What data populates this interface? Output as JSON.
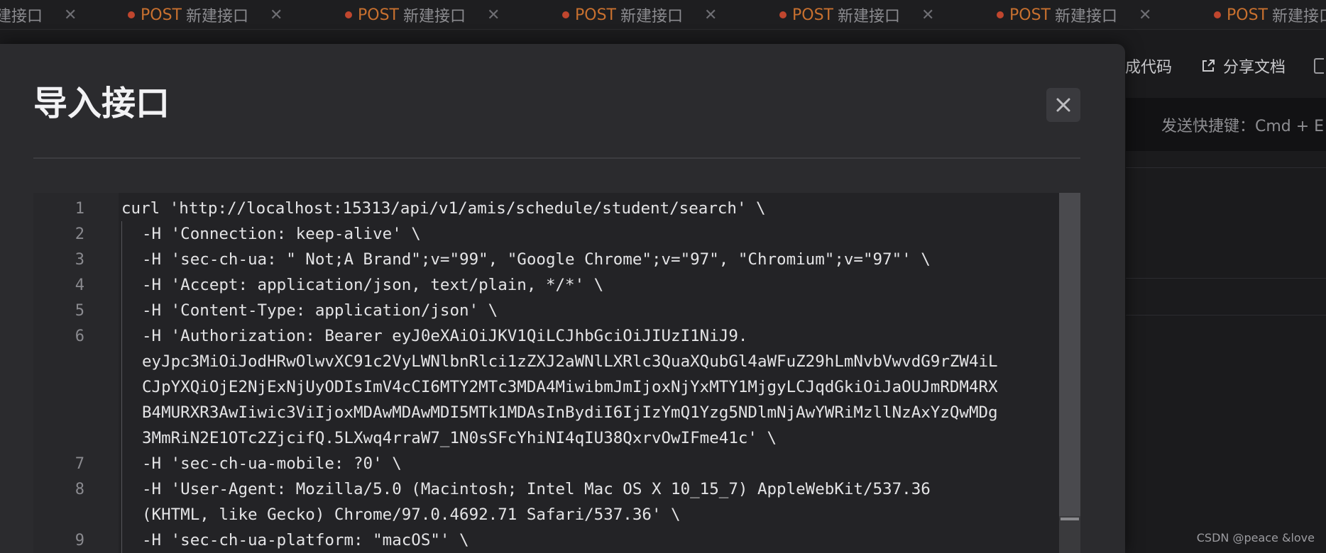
{
  "tabs": [
    {
      "method": "",
      "name": "建接口"
    },
    {
      "method": "POST",
      "name": "新建接口"
    },
    {
      "method": "POST",
      "name": "新建接口"
    },
    {
      "method": "POST",
      "name": "新建接口"
    },
    {
      "method": "POST",
      "name": "新建接口"
    },
    {
      "method": "POST",
      "name": "新建接口"
    },
    {
      "method": "POST",
      "name": "新建接口"
    }
  ],
  "tab_close_glyph": "✕",
  "colors": {
    "method_post": "#c8702f",
    "dot": "#c0462e"
  },
  "toolbar": {
    "generate_code_label": "成代码",
    "share_doc_label": "分享文档"
  },
  "send_hint": "发送快捷键：Cmd + E",
  "modal": {
    "title": "导入接口",
    "close_glyph": "✕"
  },
  "editor": {
    "lines": [
      {
        "num": "1",
        "text": "curl 'http://localhost:15313/api/v1/amis/schedule/student/search' \\"
      },
      {
        "num": "2",
        "text": "-H 'Connection: keep-alive' \\"
      },
      {
        "num": "3",
        "text": "-H 'sec-ch-ua: \" Not;A Brand\";v=\"99\", \"Google Chrome\";v=\"97\", \"Chromium\";v=\"97\"' \\"
      },
      {
        "num": "4",
        "text": "-H 'Accept: application/json, text/plain, */*' \\"
      },
      {
        "num": "5",
        "text": "-H 'Content-Type: application/json' \\"
      },
      {
        "num": "6",
        "text": "-H 'Authorization: Bearer eyJ0eXAiOiJKV1QiLCJhbGciOiJIUzI1NiJ9."
      },
      {
        "num": "",
        "text": "eyJpc3MiOiJodHRwOlwvXC91c2VyLWNlbnRlci1zZXJ2aWNlLXRlc3QuaXQubGl4aWFuZ29hLmNvbVwvdG9rZW4iL"
      },
      {
        "num": "",
        "text": "CJpYXQiOjE2NjExNjUyODIsImV4cCI6MTY2MTc3MDA4MiwibmJmIjoxNjYxMTY1MjgyLCJqdGkiOiJaOUJmRDM4RX"
      },
      {
        "num": "",
        "text": "B4MURXR3AwIiwic3ViIjoxMDAwMDAwMDI5MTk1MDAsInBydiI6IjIzYmQ1Yzg5NDlmNjAwYWRiMzllNzAxYzQwMDg"
      },
      {
        "num": "",
        "text": "3MmRiN2E1OTc2ZjcifQ.5LXwq4rraW7_1N0sSFcYhiNI4qIU38QxrvOwIFme41c' \\"
      },
      {
        "num": "7",
        "text": "-H 'sec-ch-ua-mobile: ?0' \\"
      },
      {
        "num": "8",
        "text": "-H 'User-Agent: Mozilla/5.0 (Macintosh; Intel Mac OS X 10_15_7) AppleWebKit/537.36"
      },
      {
        "num": "",
        "text": "(KHTML, like Gecko) Chrome/97.0.4692.71 Safari/537.36' \\"
      },
      {
        "num": "9",
        "text": "-H 'sec-ch-ua-platform: \"macOS\"' \\"
      }
    ]
  },
  "watermark": "CSDN @peace &love"
}
